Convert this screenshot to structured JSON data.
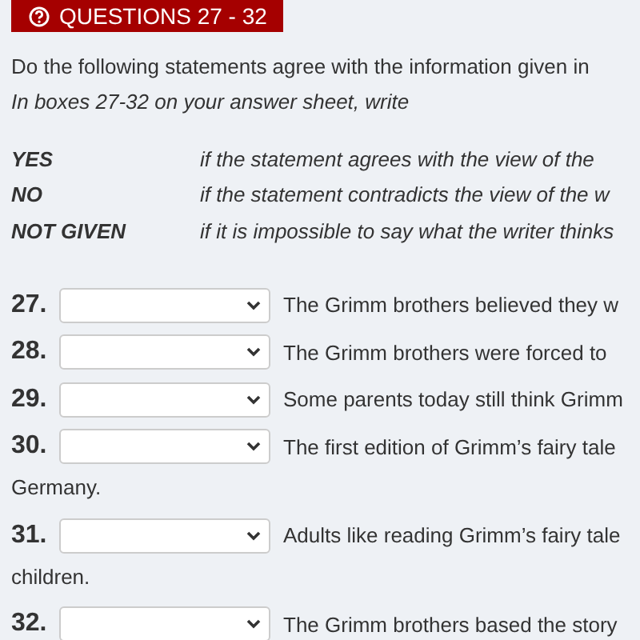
{
  "header": {
    "title": "QUESTIONS 27 - 32"
  },
  "instruction": "Do the following statements agree with the information given in",
  "subinstruction": "In boxes 27-32 on your answer sheet, write",
  "legend": [
    {
      "term": "YES",
      "meaning": "if the statement agrees with the view of the"
    },
    {
      "term": "NO",
      "meaning": "if the statement contradicts the view of the w"
    },
    {
      "term": "NOT GIVEN",
      "meaning": "if it is impossible to say what the writer thinks"
    }
  ],
  "questions": [
    {
      "number": "27.",
      "text": "The Grimm brothers believed they w"
    },
    {
      "number": "28.",
      "text": "The Grimm brothers were forced to"
    },
    {
      "number": "29.",
      "text": "Some parents today still think Grimm"
    },
    {
      "number": "30.",
      "text": "The first edition of Grimm’s fairy tale",
      "continuation": "Germany."
    },
    {
      "number": "31.",
      "text": "Adults like reading Grimm’s fairy tale",
      "continuation": "children."
    },
    {
      "number": "32.",
      "text": "The Grimm brothers based the story"
    }
  ]
}
